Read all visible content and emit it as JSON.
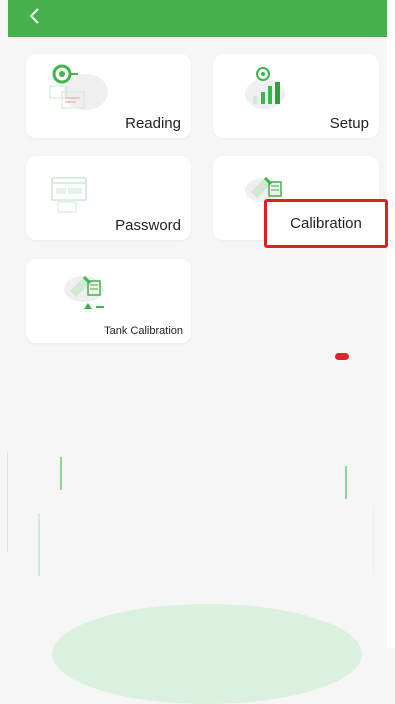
{
  "header": {
    "back_icon": "chevron-left-icon",
    "color": "#44b14d"
  },
  "menu": {
    "reading": {
      "label": "Reading",
      "icon": "gauge-target-icon"
    },
    "setup": {
      "label": "Setup",
      "icon": "chart-settings-icon"
    },
    "password": {
      "label": "Password",
      "icon": "form-window-icon"
    },
    "calibration": {
      "label": "Calibration",
      "icon": "calibration-tool-icon"
    },
    "tank_calibration": {
      "label": "Tank Calibration",
      "icon": "tank-calibration-icon"
    }
  },
  "annotation": {
    "highlight_color": "#e02020",
    "indicator_color": "#e02525"
  }
}
